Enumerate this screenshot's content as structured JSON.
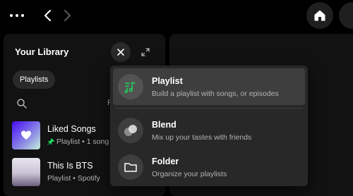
{
  "topbar": {
    "more_icon": "more-horizontal-icon",
    "back_icon": "chevron-left-icon",
    "forward_icon": "chevron-right-icon",
    "home_icon": "home-icon"
  },
  "library": {
    "title": "Your Library",
    "filter_chip": "Playlists",
    "sort_partial": "R",
    "items": [
      {
        "title": "Liked Songs",
        "subtitle": "Playlist • 1 song",
        "pinned": true
      },
      {
        "title": "This Is BTS",
        "subtitle": "Playlist • Spotify",
        "pinned": false
      }
    ]
  },
  "create_menu": {
    "items": [
      {
        "title": "Playlist",
        "subtitle": "Build a playlist with songs, or episodes",
        "icon": "playlist-music-icon"
      },
      {
        "title": "Blend",
        "subtitle": "Mix up your tastes with friends",
        "icon": "blend-icon"
      },
      {
        "title": "Folder",
        "subtitle": "Organize your playlists",
        "icon": "folder-icon"
      }
    ]
  },
  "colors": {
    "accent": "#1ed760",
    "background": "#000000",
    "panel": "#121212",
    "menu": "#282828"
  }
}
